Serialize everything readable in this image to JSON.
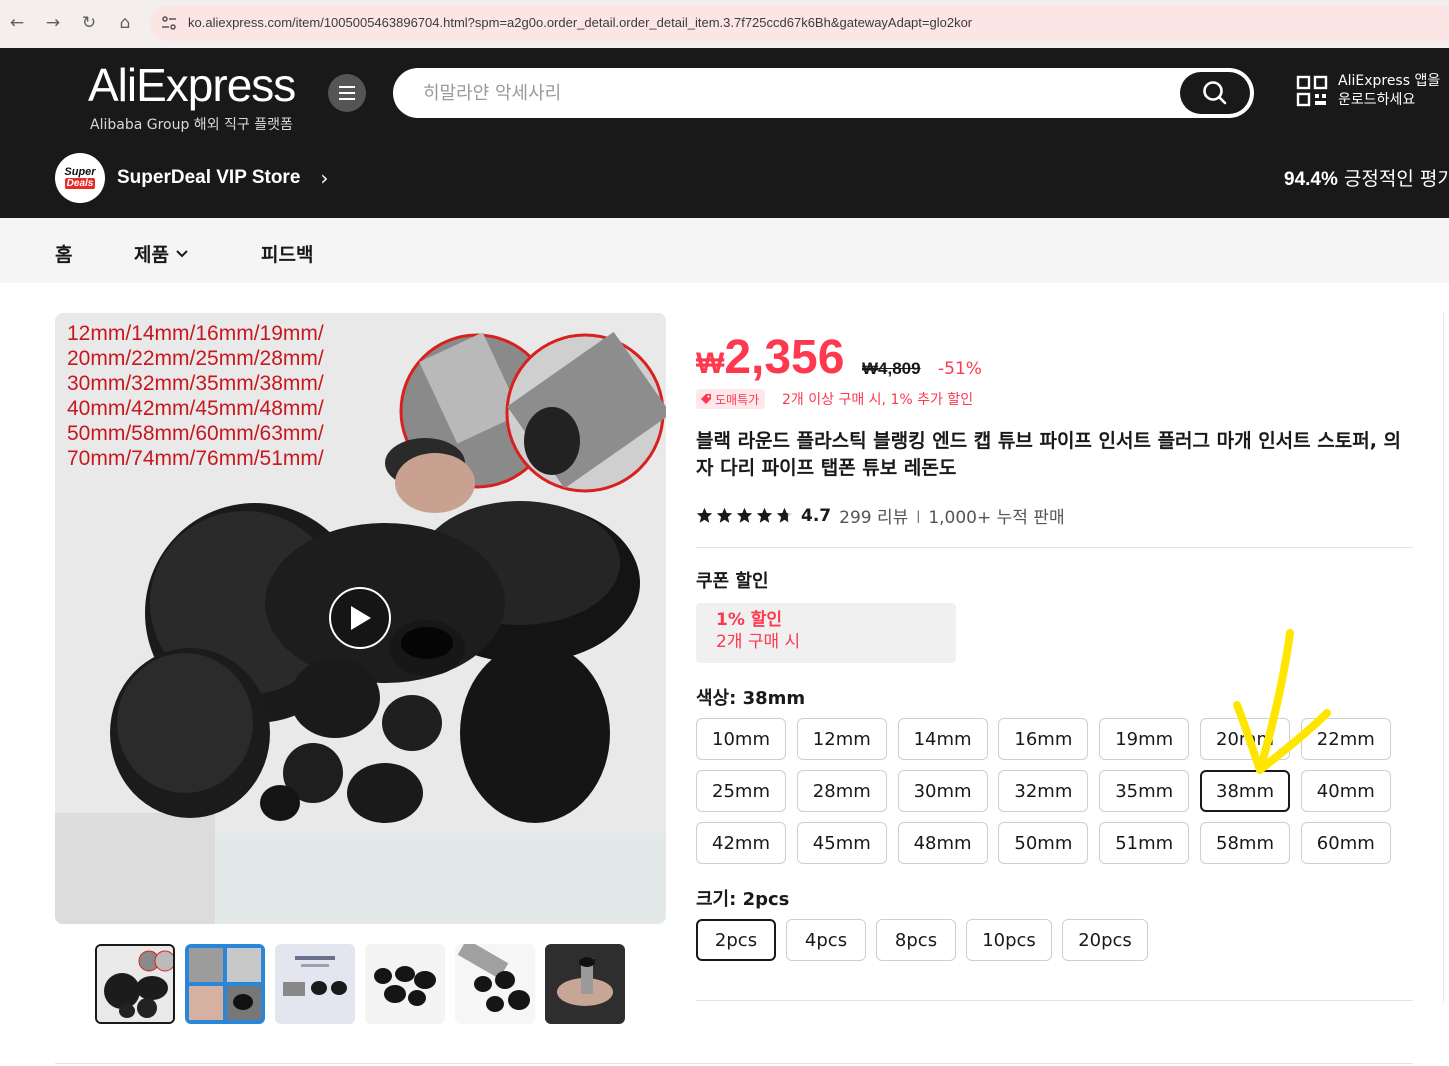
{
  "browser": {
    "url": "ko.aliexpress.com/item/1005005463896704.html?spm=a2g0o.order_detail.order_detail_item.3.7f725ccd67k6Bh&gatewayAdapt=glo2kor"
  },
  "header": {
    "logo": "AliExpress",
    "logo_sub": "Alibaba Group 해외 직구 플랫폼",
    "search_placeholder": "히말라얀 악세사리",
    "app_line1": "AliExpress 앱을",
    "app_line2": "운로드하세요"
  },
  "store": {
    "logo_top": "Super",
    "logo_bottom": "Deals",
    "name": "SuperDeal VIP Store",
    "positive_pct": "94.4%",
    "positive_label": "긍정적인 평가"
  },
  "subnav": {
    "home": "홈",
    "products": "제품",
    "feedback": "피드백"
  },
  "gallery": {
    "sizes_text": "12mm/14mm/16mm/19mm/\n20mm/22mm/25mm/28mm/\n30mm/32mm/35mm/38mm/\n40mm/42mm/45mm/48mm/\n50mm/58mm/60mm/63mm/\n70mm/74mm/76mm/51mm/"
  },
  "product": {
    "currency": "₩",
    "price": "2,356",
    "old_price": "₩4,809",
    "discount": "-51%",
    "wholesale_badge": "도매특가",
    "wholesale_text": "2개 이상 구매 시, 1% 추가 할인",
    "title": "블랙 라운드 플라스틱 블랭킹 엔드 캡 튜브 파이프 인서트 플러그 마개 인서트 스토퍼, 의자 다리 파이프 탭폰 튜보 레돈도",
    "rating": "4.7",
    "reviews": "299 리뷰",
    "sold": "1,000+ 누적 판매",
    "stars": 4.7
  },
  "coupon": {
    "label": "쿠폰 할인",
    "pct": "1% 할인",
    "condition": "2개 구매 시"
  },
  "color": {
    "label": "색상: 38mm",
    "options": [
      "10mm",
      "12mm",
      "14mm",
      "16mm",
      "19mm",
      "20mm",
      "22mm",
      "25mm",
      "28mm",
      "30mm",
      "32mm",
      "35mm",
      "38mm",
      "40mm",
      "42mm",
      "45mm",
      "48mm",
      "50mm",
      "51mm",
      "58mm",
      "60mm"
    ],
    "selected": "38mm"
  },
  "size": {
    "label": "크기: 2pcs",
    "options": [
      "2pcs",
      "4pcs",
      "8pcs",
      "10pcs",
      "20pcs"
    ],
    "selected": "2pcs"
  },
  "colors": {
    "accent": "#fd384f",
    "header_bg": "#191919",
    "annotation": "#ffe600"
  }
}
